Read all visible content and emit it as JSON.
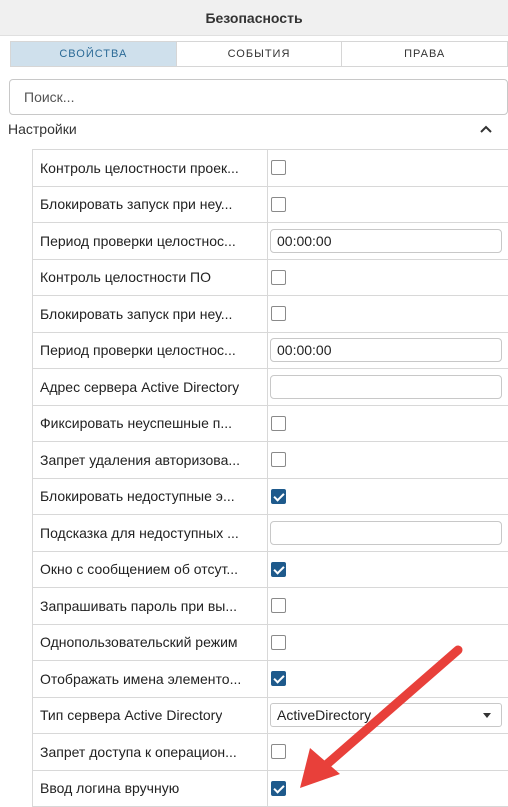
{
  "header": {
    "title": "Безопасность"
  },
  "tabs": [
    {
      "label": "СВОЙСТВА",
      "active": true
    },
    {
      "label": "СОБЫТИЯ",
      "active": false
    },
    {
      "label": "ПРАВА",
      "active": false
    }
  ],
  "search": {
    "placeholder": "Поиск..."
  },
  "section": {
    "title": "Настройки",
    "icon": "chevron-up-icon"
  },
  "properties": [
    {
      "label": "Контроль целостности проек...",
      "type": "checkbox",
      "checked": false
    },
    {
      "label": "Блокировать запуск при неу...",
      "type": "checkbox",
      "checked": false
    },
    {
      "label": "Период проверки целостнос...",
      "type": "text",
      "value": "00:00:00"
    },
    {
      "label": "Контроль целостности ПО",
      "type": "checkbox",
      "checked": false
    },
    {
      "label": "Блокировать запуск при неу...",
      "type": "checkbox",
      "checked": false
    },
    {
      "label": "Период проверки целостнос...",
      "type": "text",
      "value": "00:00:00"
    },
    {
      "label": "Адрес сервера Active Directory",
      "type": "text",
      "value": ""
    },
    {
      "label": "Фиксировать неуспешные п...",
      "type": "checkbox",
      "checked": false
    },
    {
      "label": "Запрет удаления авторизова...",
      "type": "checkbox",
      "checked": false
    },
    {
      "label": "Блокировать недоступные э...",
      "type": "checkbox",
      "checked": true
    },
    {
      "label": "Подсказка для недоступных ...",
      "type": "text",
      "value": ""
    },
    {
      "label": "Окно с сообщением об отсут...",
      "type": "checkbox",
      "checked": true
    },
    {
      "label": "Запрашивать пароль при вы...",
      "type": "checkbox",
      "checked": false
    },
    {
      "label": "Однопользовательский режим",
      "type": "checkbox",
      "checked": false
    },
    {
      "label": "Отображать имена элементо...",
      "type": "checkbox",
      "checked": true
    },
    {
      "label": "Тип сервера Active Directory",
      "type": "select",
      "value": "ActiveDirectory"
    },
    {
      "label": "Запрет доступа к операцион...",
      "type": "checkbox",
      "checked": false
    },
    {
      "label": "Ввод логина вручную",
      "type": "checkbox",
      "checked": true
    }
  ],
  "colors": {
    "accent": "#1e5a8c",
    "tab_active_bg": "#cfe0ec",
    "annotation_arrow": "#e8403a"
  }
}
